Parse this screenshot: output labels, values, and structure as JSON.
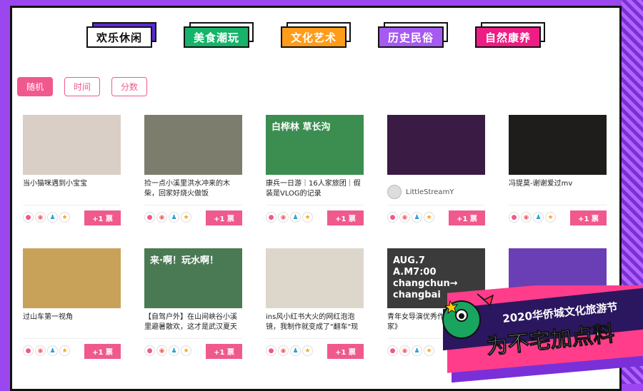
{
  "categories": [
    {
      "label": "欢乐休闲",
      "color": "#ffffff"
    },
    {
      "label": "美食潮玩",
      "color": "#17b36b"
    },
    {
      "label": "文化艺术",
      "color": "#ff9c1a"
    },
    {
      "label": "历史民俗",
      "color": "#a55af0"
    },
    {
      "label": "自然康养",
      "color": "#ee1d83"
    }
  ],
  "sort_buttons": [
    {
      "label": "随机",
      "active": true
    },
    {
      "label": "时间",
      "active": false
    },
    {
      "label": "分数",
      "active": false
    }
  ],
  "vote_label": "+1 票",
  "items": [
    {
      "title": "当小猫咪遇到小宝宝",
      "thumb_bg": "#d9cfc6",
      "thumb_text": ""
    },
    {
      "title": "捡一点小溪里洪水冲来的木柴，回家好烧火做饭",
      "thumb_bg": "#7c7d6d",
      "thumb_text": ""
    },
    {
      "title": "康兵一日游｜16人家旅团｜假装是VLOG的记录",
      "thumb_bg": "#3b8d50",
      "thumb_text": "白桦林  草长沟"
    },
    {
      "title": "",
      "thumb_bg": "#3a1b44",
      "thumb_text": "",
      "author": "LittleStreamY"
    },
    {
      "title": "冯提莫-谢谢爱过mv",
      "thumb_bg": "#1f1d1c",
      "thumb_text": ""
    },
    {
      "title": "过山车第一视角",
      "thumb_bg": "#c9a25a",
      "thumb_text": ""
    },
    {
      "title": "【自驾户外】在山间峡谷小溪里避暑散欢，这才是武汉夏天",
      "thumb_bg": "#4a7a54",
      "thumb_text": "来·啊！玩水啊！"
    },
    {
      "title": "ins风小红书大火的网红泡泡镜，我制作就变成了\"翻车\"现",
      "thumb_bg": "#ddd7cb",
      "thumb_text": ""
    },
    {
      "title": "青年女导演优秀作品·下我的家》",
      "thumb_bg": "#3b3b3b",
      "thumb_text": "AUG.7\nA.M7:00\nchangchun→\nchangbai"
    },
    {
      "title": "",
      "thumb_bg": "#6a3fb5",
      "thumb_text": ""
    }
  ],
  "banner": {
    "subtitle": "2020华侨城文化旅游节",
    "title": "为不宅加点料"
  }
}
